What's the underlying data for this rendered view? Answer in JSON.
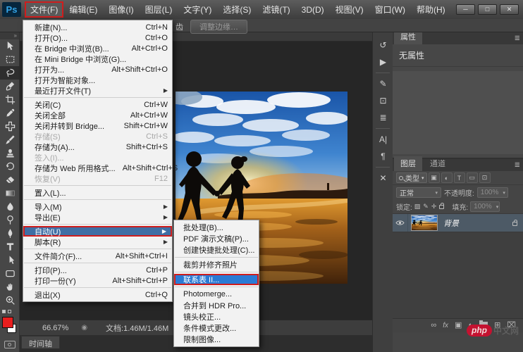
{
  "titlebar": {
    "logo": "Ps",
    "menus": [
      {
        "label": "文件(F)",
        "active": true
      },
      {
        "label": "编辑(E)"
      },
      {
        "label": "图像(I)"
      },
      {
        "label": "图层(L)"
      },
      {
        "label": "文字(Y)"
      },
      {
        "label": "选择(S)"
      },
      {
        "label": "滤镜(T)"
      },
      {
        "label": "3D(D)"
      },
      {
        "label": "视图(V)"
      },
      {
        "label": "窗口(W)"
      },
      {
        "label": "帮助(H)"
      }
    ],
    "window_controls": [
      {
        "name": "minimize-button",
        "glyph": "─"
      },
      {
        "name": "maximize-button",
        "glyph": "□"
      },
      {
        "name": "close-button",
        "glyph": "✕"
      }
    ]
  },
  "options_bar": {
    "antialias_fragment": "齿",
    "refine_edge_button": "调整边缘…"
  },
  "file_menu": {
    "items": [
      {
        "label": "新建(N)...",
        "shortcut": "Ctrl+N"
      },
      {
        "label": "打开(O)...",
        "shortcut": "Ctrl+O"
      },
      {
        "label": "在 Bridge 中浏览(B)...",
        "shortcut": "Alt+Ctrl+O"
      },
      {
        "label": "在 Mini Bridge 中浏览(G)..."
      },
      {
        "label": "打开为...",
        "shortcut": "Alt+Shift+Ctrl+O"
      },
      {
        "label": "打开为智能对象..."
      },
      {
        "label": "最近打开文件(T)",
        "arrow": true
      },
      {
        "sep": true
      },
      {
        "label": "关闭(C)",
        "shortcut": "Ctrl+W"
      },
      {
        "label": "关闭全部",
        "shortcut": "Alt+Ctrl+W"
      },
      {
        "label": "关闭并转到 Bridge...",
        "shortcut": "Shift+Ctrl+W"
      },
      {
        "label": "存储(S)",
        "shortcut": "Ctrl+S",
        "disabled": true
      },
      {
        "label": "存储为(A)...",
        "shortcut": "Shift+Ctrl+S"
      },
      {
        "label": "签入(I)...",
        "disabled": true
      },
      {
        "label": "存储为 Web 所用格式...",
        "shortcut": "Alt+Shift+Ctrl+S"
      },
      {
        "label": "恢复(V)",
        "shortcut": "F12",
        "disabled": true
      },
      {
        "sep": true
      },
      {
        "label": "置入(L)..."
      },
      {
        "sep": true
      },
      {
        "label": "导入(M)",
        "arrow": true
      },
      {
        "label": "导出(E)",
        "arrow": true
      },
      {
        "sep": true
      },
      {
        "label": "自动(U)",
        "arrow": true,
        "highlighted": true
      },
      {
        "label": "脚本(R)",
        "arrow": true
      },
      {
        "sep": true
      },
      {
        "label": "文件简介(F)...",
        "shortcut": "Alt+Shift+Ctrl+I"
      },
      {
        "sep": true
      },
      {
        "label": "打印(P)...",
        "shortcut": "Ctrl+P"
      },
      {
        "label": "打印一份(Y)",
        "shortcut": "Alt+Shift+Ctrl+P"
      },
      {
        "sep": true
      },
      {
        "label": "退出(X)",
        "shortcut": "Ctrl+Q"
      }
    ]
  },
  "automate_menu": {
    "items": [
      {
        "label": "批处理(B)..."
      },
      {
        "label": "PDF 演示文稿(P)..."
      },
      {
        "label": "创建快捷批处理(C)..."
      },
      {
        "sep": true
      },
      {
        "label": "裁剪并修齐照片"
      },
      {
        "sep": true
      },
      {
        "label": "联系表 II...",
        "highlighted": true
      },
      {
        "sep": true
      },
      {
        "label": "Photomerge..."
      },
      {
        "label": "合并到 HDR Pro..."
      },
      {
        "label": "镜头校正..."
      },
      {
        "label": "条件模式更改..."
      },
      {
        "label": "限制图像..."
      }
    ]
  },
  "toolbox": {
    "collapse_glyph": "»",
    "tools": [
      {
        "name": "move-tool"
      },
      {
        "name": "marquee-tool"
      },
      {
        "name": "lasso-tool",
        "selected": true
      },
      {
        "name": "quick-selection-tool"
      },
      {
        "name": "crop-tool"
      },
      {
        "name": "eyedropper-tool"
      },
      {
        "name": "healing-brush-tool"
      },
      {
        "name": "brush-tool"
      },
      {
        "name": "clone-stamp-tool"
      },
      {
        "name": "history-brush-tool"
      },
      {
        "name": "eraser-tool"
      },
      {
        "name": "gradient-tool"
      },
      {
        "name": "smudge-tool"
      },
      {
        "name": "dodge-tool"
      },
      {
        "name": "pen-tool"
      },
      {
        "name": "type-tool"
      },
      {
        "name": "path-selection-tool"
      },
      {
        "name": "shape-tool"
      },
      {
        "name": "hand-tool"
      },
      {
        "name": "zoom-tool"
      }
    ],
    "foreground_color": "#e81e1e",
    "background_color": "#ffffff"
  },
  "dock": {
    "icons": [
      {
        "name": "history-panel-icon",
        "glyph": "↺"
      },
      {
        "name": "actions-panel-icon",
        "glyph": "▶"
      },
      {
        "sep": true
      },
      {
        "name": "brush-panel-icon",
        "glyph": "✎"
      },
      {
        "name": "clone-source-panel-icon",
        "glyph": "⊡"
      },
      {
        "name": "layer-comps-panel-icon",
        "glyph": "≣"
      },
      {
        "sep": true
      },
      {
        "name": "character-panel-icon",
        "glyph": "A|"
      },
      {
        "name": "paragraph-panel-icon",
        "glyph": "¶"
      },
      {
        "sep": true
      },
      {
        "name": "tool-presets-panel-icon",
        "glyph": "✕"
      }
    ]
  },
  "properties_panel": {
    "tab": "属性",
    "panel_menu_glyph": "≣",
    "empty_text": "无属性"
  },
  "layers_panel": {
    "tabs": [
      {
        "label": "图层",
        "active": true
      },
      {
        "label": "通道"
      }
    ],
    "panel_menu_glyph": "≣",
    "filter": {
      "kind_label": "类型",
      "caret": "▾",
      "icons": [
        {
          "name": "filter-image-icon",
          "glyph": "▣"
        },
        {
          "name": "filter-adjustment-icon",
          "glyph": "◐"
        },
        {
          "name": "filter-type-icon",
          "glyph": "T"
        },
        {
          "name": "filter-shape-icon",
          "glyph": "▭"
        },
        {
          "name": "filter-smartobject-icon",
          "glyph": "⊡"
        }
      ]
    },
    "blend_mode": "正常",
    "opacity_label": "不透明度:",
    "opacity_value": "100%",
    "lock_label": "锁定:",
    "lock_icons": [
      {
        "name": "lock-transparency-icon",
        "glyph": "▨"
      },
      {
        "name": "lock-paint-icon",
        "glyph": "✎"
      },
      {
        "name": "lock-position-icon",
        "glyph": "✛"
      }
    ],
    "fill_label": "填充:",
    "fill_value": "100%",
    "layer": {
      "name": "背景",
      "visible": true,
      "locked": true
    },
    "footer_icons": [
      {
        "name": "link-layers-icon",
        "glyph": "∞"
      },
      {
        "name": "layer-style-icon",
        "glyph": "fx"
      },
      {
        "name": "layer-mask-icon",
        "glyph": "▣"
      },
      {
        "name": "adjustment-layer-icon",
        "glyph": "◐"
      },
      {
        "name": "layer-group-icon",
        "glyph": "folder"
      },
      {
        "name": "new-layer-icon",
        "glyph": "⊞"
      },
      {
        "name": "delete-layer-icon",
        "glyph": "⌧"
      }
    ]
  },
  "status_bar": {
    "zoom_level": "66.67%",
    "info_icon_glyph": "◉",
    "doc_info": "文档:1.46M/1.46M",
    "arrow_glyph": "▶"
  },
  "timeline": {
    "tab": "时间轴"
  },
  "watermark": {
    "badge": "php",
    "suffix": "中文网"
  },
  "annotation_color": "#cf1d1d"
}
